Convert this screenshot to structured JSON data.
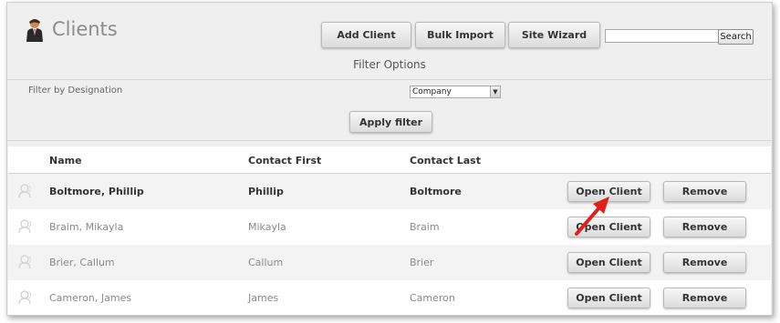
{
  "header": {
    "title": "Clients",
    "buttons": {
      "add_client": "Add Client",
      "bulk_import": "Bulk Import",
      "site_wizard": "Site Wizard"
    },
    "search": {
      "value": "",
      "button_label": "Search"
    }
  },
  "filter": {
    "title": "Filter Options",
    "label": "Filter by Designation",
    "select_value": "Company",
    "apply_label": "Apply filter"
  },
  "table": {
    "columns": {
      "name": "Name",
      "contact_first": "Contact First",
      "contact_last": "Contact Last"
    },
    "rows": [
      {
        "name": "Boltmore, Phillip",
        "first": "Phillip",
        "last": "Boltmore",
        "open": "Open Client",
        "remove": "Remove"
      },
      {
        "name": "Braim, Mikayla",
        "first": "Mikayla",
        "last": "Braim",
        "open": "Open Client",
        "remove": "Remove"
      },
      {
        "name": "Brier, Callum",
        "first": "Callum",
        "last": "Brier",
        "open": "Open Client",
        "remove": "Remove"
      },
      {
        "name": "Cameron, James",
        "first": "James",
        "last": "Cameron",
        "open": "Open Client",
        "remove": "Remove"
      }
    ]
  },
  "colors": {
    "frame_bg": "#efefef",
    "annotation_arrow": "#e0201c"
  },
  "icons": {
    "header": "person-icon",
    "row": "user-silhouette-icon",
    "select": "chevron-down-icon"
  }
}
